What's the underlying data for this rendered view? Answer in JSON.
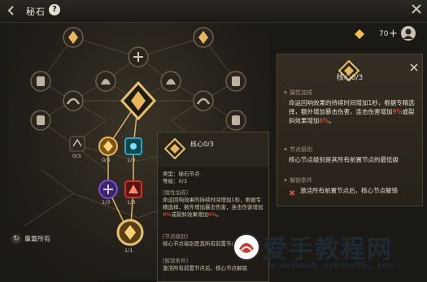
{
  "header": {
    "title": "秘石",
    "help": "?"
  },
  "currency": {
    "value": "70",
    "plus": "+"
  },
  "tree": {
    "node_counts": {
      "left_small": "0/3",
      "mid_gold": "0/3",
      "mid_teal": "1/3",
      "low_purple": "1/3",
      "low_red": "1/3",
      "bottom": "1/1"
    }
  },
  "reset_label": "重置所有",
  "side_panel": {
    "title": "核心0/3",
    "section1_header": "属性加成",
    "section1_text_a": "命运回响效果的持续时间增加1秒，根据专精选择，额外增加暴击伤害，连击伤害增加",
    "section1_hl_a": "9%",
    "section1_text_b": "或裂斜效果增加",
    "section1_hl_b": "6%",
    "section1_text_c": "。",
    "section2_header": "节点级别",
    "section2_text": "核心节点级别是其所有前置节点的最低级",
    "section3_header": "解锁条件",
    "section3_text": "激活所有前置节点后，核心节点解锁"
  },
  "tooltip": {
    "title": "核心0/3",
    "type_line": "类型：秘石节点",
    "level_line": "等级：0/3",
    "attr_header": "[属性加成]",
    "attr_text_a": "命运回响效果的持续时间增加1秒，根据专精选择，额外增加暴击伤害，连击伤害增加",
    "attr_hl_a": "9%",
    "attr_text_b": "或裂斜效果增加",
    "attr_hl_b": "6%",
    "attr_text_c": "。",
    "node_header": "[节点级别]",
    "node_text": "核心节点级别是其所有前置节点的最低级",
    "unlock_header": "[解锁条件]",
    "unlock_text": "激活所有前置节点后，核心节点解锁"
  },
  "watermark": {
    "brand": "爱手教程网",
    "url": "m.ewiwwwb.echiha98c.com"
  },
  "colors": {
    "accent_gold": "#e6b85a",
    "highlight_red": "#ff5a3a",
    "teal": "#2aa6b8",
    "purple": "#7c4bd6",
    "red_node": "#c9342b"
  }
}
